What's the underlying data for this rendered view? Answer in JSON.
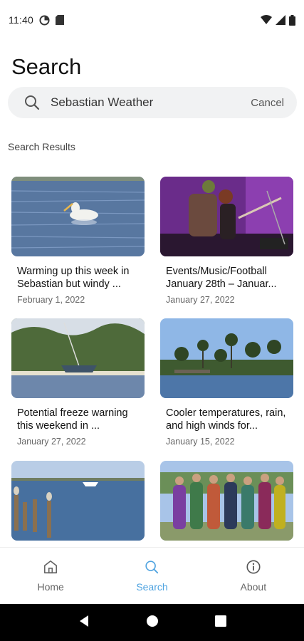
{
  "status_bar": {
    "time": "11:40"
  },
  "page": {
    "title": "Search"
  },
  "search": {
    "value": "Sebastian Weather",
    "cancel_label": "Cancel"
  },
  "results_label": "Search Results",
  "results": [
    {
      "title": "Warming up this week in Sebastian but windy ...",
      "date": "February 1, 2022",
      "image": "pelican-on-water"
    },
    {
      "title": "Events/Music/Football January 28th – Januar...",
      "date": "January 27, 2022",
      "image": "band-performing"
    },
    {
      "title": "Potential freeze warning this weekend in ...",
      "date": "January 27, 2022",
      "image": "sailboat-shoreline"
    },
    {
      "title": "Cooler temperatures, rain, and high winds for...",
      "date": "January 15, 2022",
      "image": "palm-trees-river"
    },
    {
      "title": "",
      "date": "",
      "image": "pelicans-on-pilings"
    },
    {
      "title": "",
      "date": "",
      "image": "costumed-group"
    }
  ],
  "bottom_nav": {
    "items": [
      {
        "label": "Home",
        "icon": "home-icon"
      },
      {
        "label": "Search",
        "icon": "search-icon"
      },
      {
        "label": "About",
        "icon": "info-icon"
      }
    ],
    "active": "Search"
  },
  "colors": {
    "accent": "#4fa3e0",
    "search_bg": "#f1f2f3",
    "system_nav": "#000000"
  }
}
